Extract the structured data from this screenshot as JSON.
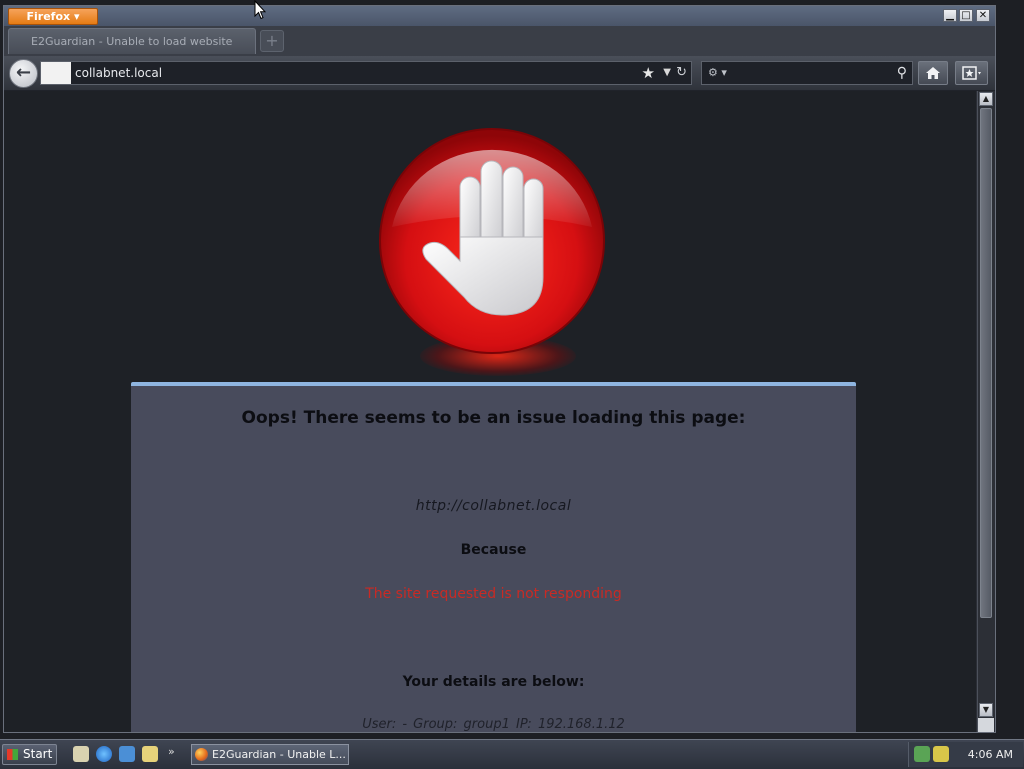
{
  "browser": {
    "menu_button": "Firefox",
    "window_controls": {
      "minimize": "▁",
      "maximize": "□",
      "close": "✕"
    },
    "tab": {
      "title": "E2Guardian - Unable to load website"
    },
    "new_tab_symbol": "+",
    "url": "collabnet.local",
    "search_placeholder": "",
    "icons": {
      "back": "back-arrow-icon",
      "bookmark": "star-icon",
      "reload": "reload-icon",
      "search": "magnifier-icon",
      "home": "home-icon",
      "bookmarks_menu": "bookmarks-icon"
    }
  },
  "page": {
    "title": "Oops! There seems to be an issue loading this page:",
    "blocked_url": "http://collabnet.local",
    "because_label": "Because",
    "reason": "The site requested is not responding",
    "details_heading": "Your details are below:",
    "details_line": "User: -   Group: group1   IP: 192.168.1.12",
    "colors": {
      "card_bg": "#484b5c",
      "reason_text": "#c92a24",
      "stop_red": "#e0141a"
    }
  },
  "taskbar": {
    "start_label": "Start",
    "task_label": "E2Guardian - Unable L...",
    "clock": "4:06 AM"
  }
}
